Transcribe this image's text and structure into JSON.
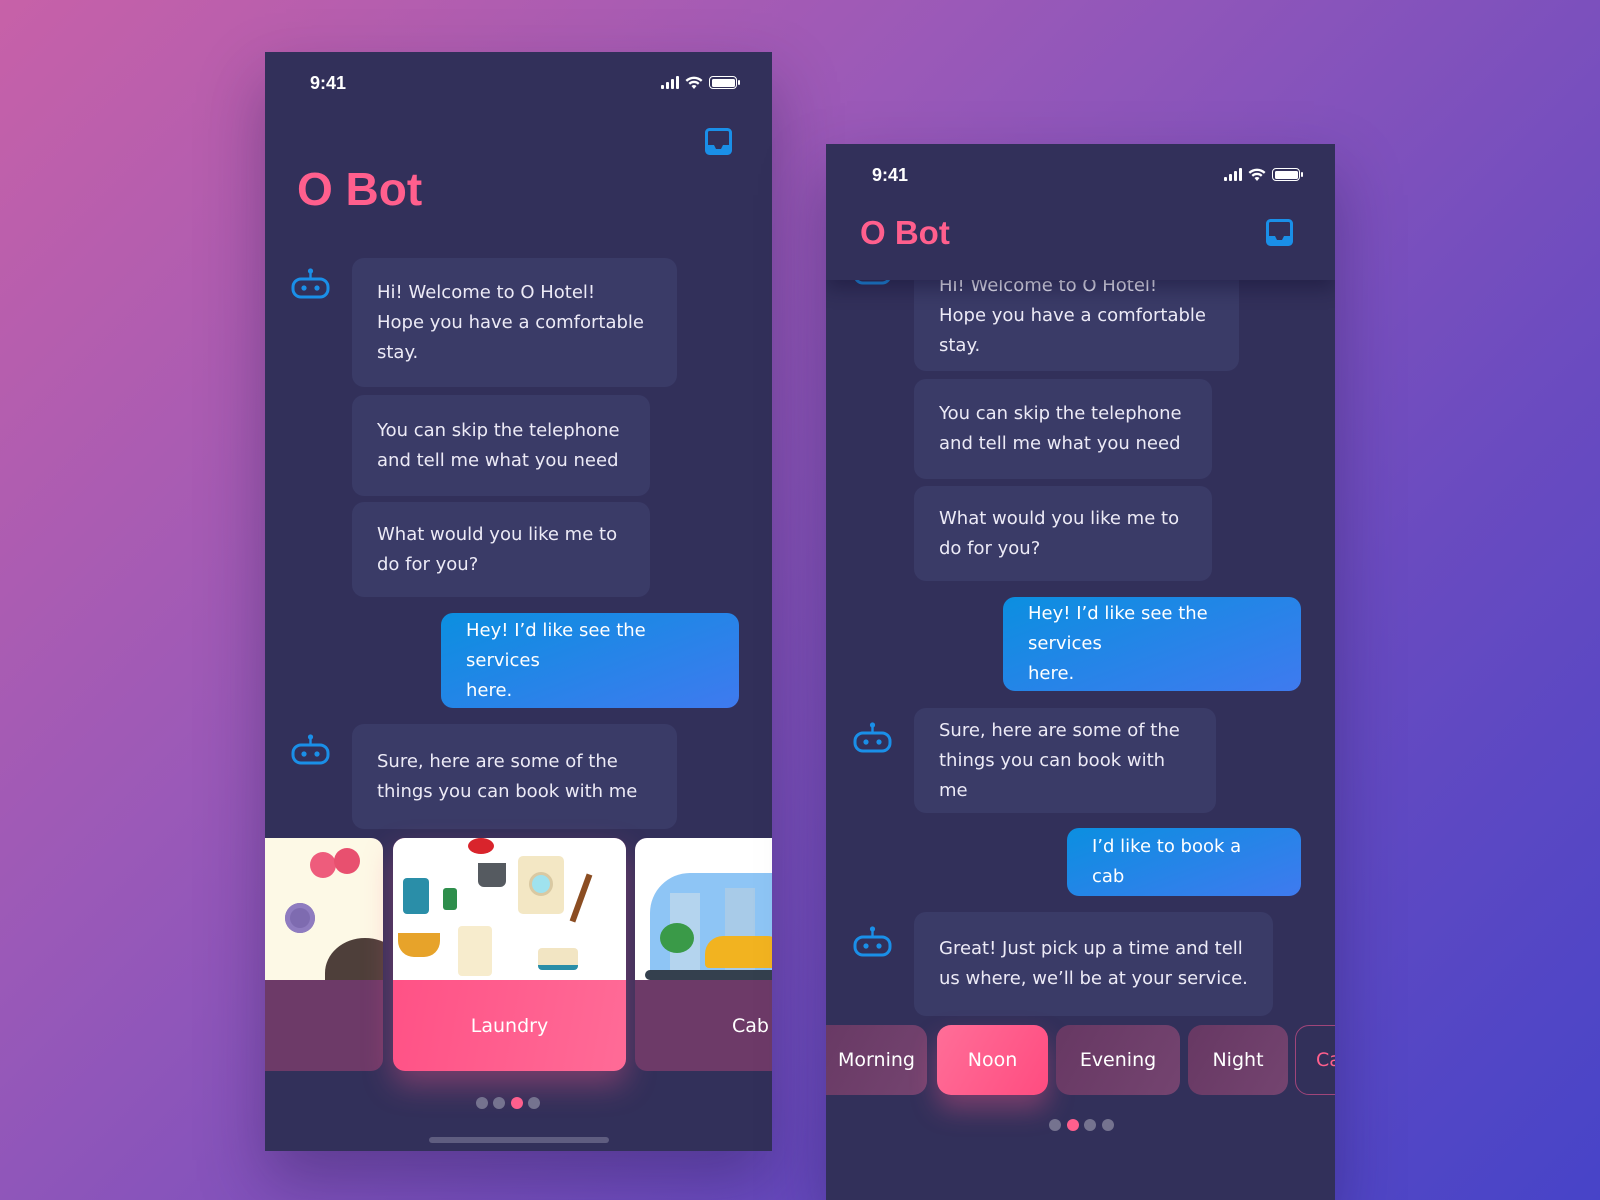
{
  "colors": {
    "accent_pink": "#ff5f8d",
    "user_bubble": "#2d84ec",
    "bot_bubble": "#3a3b67",
    "robot_icon": "#1a8fe8",
    "screen_bg": "#32305a"
  },
  "left_phone": {
    "status": {
      "time": "9:41",
      "icons": [
        "signal-icon",
        "wifi-icon",
        "battery-icon"
      ]
    },
    "title": "O Bot",
    "messages": [
      {
        "from": "bot",
        "lines": [
          "Hi! Welcome to O Hotel!",
          "Hope you have a comfortable",
          "stay."
        ]
      },
      {
        "from": "bot",
        "lines": [
          "You can skip the telephone",
          "and tell me what you need"
        ]
      },
      {
        "from": "bot",
        "lines": [
          "What would you like me to",
          "do for you?"
        ]
      },
      {
        "from": "user",
        "lines": [
          "Hey! I’d like see the services",
          "here."
        ]
      },
      {
        "from": "bot",
        "lines": [
          "Sure, here are some of the",
          "things you can book with me"
        ]
      }
    ],
    "cards": [
      {
        "label": ""
      },
      {
        "label": "Laundry",
        "selected": true
      },
      {
        "label": "Cab"
      }
    ],
    "pager": {
      "count": 4,
      "active": 3
    }
  },
  "right_phone": {
    "status": {
      "time": "9:41",
      "icons": [
        "signal-icon",
        "wifi-icon",
        "battery-icon"
      ]
    },
    "title": "O Bot",
    "messages": [
      {
        "from": "bot",
        "lines": [
          "Hi! Welcome to O Hotel!",
          "Hope you have a comfortable",
          "stay."
        ]
      },
      {
        "from": "bot",
        "lines": [
          "You can skip the telephone",
          "and tell me what you need"
        ]
      },
      {
        "from": "bot",
        "lines": [
          "What would you like me to",
          "do for you?"
        ]
      },
      {
        "from": "user",
        "lines": [
          "Hey! I’d like see the services",
          "here."
        ]
      },
      {
        "from": "bot",
        "lines": [
          "Sure, here are some of the",
          "things you can book with me"
        ]
      },
      {
        "from": "user",
        "lines": [
          "I’d like to book a cab"
        ]
      },
      {
        "from": "bot",
        "lines": [
          "Great! Just pick up a time and tell",
          "us where, we’ll be at your service."
        ]
      }
    ],
    "chips": [
      {
        "label": "Morning"
      },
      {
        "label": "Noon",
        "selected": true
      },
      {
        "label": "Evening"
      },
      {
        "label": "Night"
      },
      {
        "label": "Ca"
      }
    ],
    "pager": {
      "count": 4,
      "active": 2
    }
  }
}
